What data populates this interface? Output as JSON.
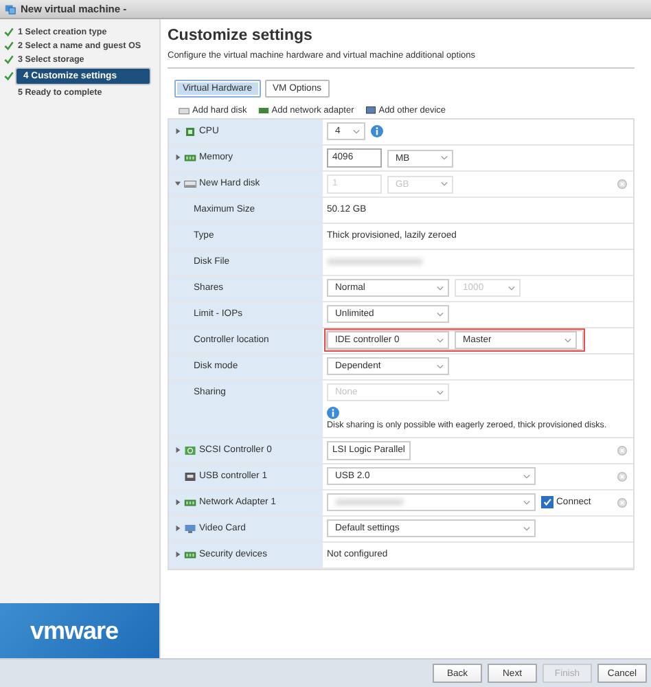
{
  "window": {
    "title": "New virtual machine -"
  },
  "steps": [
    {
      "label": "1 Select creation type",
      "done": true,
      "selected": false
    },
    {
      "label": "2 Select a name and guest OS",
      "done": true,
      "selected": false
    },
    {
      "label": "3 Select storage",
      "done": true,
      "selected": false
    },
    {
      "label": "4 Customize settings",
      "done": true,
      "selected": true
    },
    {
      "label": "5 Ready to complete",
      "done": false,
      "selected": false
    }
  ],
  "logo": "vmware",
  "heading": "Customize settings",
  "subtitle": "Configure the virtual machine hardware and virtual machine additional options",
  "tabs": [
    {
      "label": "Virtual Hardware",
      "selected": true
    },
    {
      "label": "VM Options",
      "selected": false
    }
  ],
  "toolbar": [
    "Add hard disk",
    "Add network adapter",
    "Add other device"
  ],
  "rows": [
    {
      "kind": "device",
      "label": "CPU",
      "expanded": false,
      "controls": [
        {
          "kind": "select",
          "value": "4"
        },
        {
          "kind": "info"
        }
      ]
    },
    {
      "kind": "device",
      "label": "Memory",
      "expanded": false,
      "controls": [
        {
          "kind": "input",
          "value": "4096"
        },
        {
          "kind": "select",
          "value": "MB"
        }
      ]
    },
    {
      "kind": "device",
      "label": "New Hard disk",
      "expanded": true,
      "removable": true,
      "controls": [
        {
          "kind": "input",
          "value": "1",
          "disabled": true
        },
        {
          "kind": "select",
          "value": "GB",
          "disabled": true
        }
      ]
    },
    {
      "kind": "property",
      "label": "Maximum Size",
      "controls": [
        {
          "kind": "text",
          "value": "50.12 GB"
        }
      ]
    },
    {
      "kind": "property",
      "label": "Type",
      "controls": [
        {
          "kind": "text",
          "value": "Thick provisioned, lazily zeroed"
        }
      ]
    },
    {
      "kind": "property",
      "label": "Disk File",
      "controls": [
        {
          "kind": "blurred"
        }
      ]
    },
    {
      "kind": "property",
      "label": "Shares",
      "controls": [
        {
          "kind": "select",
          "value": "Normal"
        },
        {
          "kind": "select",
          "value": "1000",
          "disabled": true
        }
      ]
    },
    {
      "kind": "property",
      "label": "Limit - IOPs",
      "controls": [
        {
          "kind": "select",
          "value": "Unlimited"
        }
      ]
    },
    {
      "kind": "property",
      "label": "Controller location",
      "highlighted": true,
      "controls": [
        {
          "kind": "select",
          "value": "IDE controller 0"
        },
        {
          "kind": "select",
          "value": "Master"
        }
      ]
    },
    {
      "kind": "property",
      "label": "Disk mode",
      "controls": [
        {
          "kind": "select",
          "value": "Dependent"
        }
      ]
    },
    {
      "kind": "property",
      "label": "Sharing",
      "controls": [
        {
          "kind": "select",
          "value": "None",
          "disabled": true
        },
        {
          "kind": "note",
          "value": "Disk sharing is only possible with eagerly zeroed, thick provisioned disks."
        }
      ]
    },
    {
      "kind": "device",
      "label": "SCSI Controller 0",
      "expanded": false,
      "removable": true,
      "controls": [
        {
          "kind": "input",
          "value": "LSI Logic Parallel"
        }
      ]
    },
    {
      "kind": "device",
      "label": "USB controller 1",
      "removable": true,
      "controls": [
        {
          "kind": "select",
          "value": "USB 2.0"
        }
      ]
    },
    {
      "kind": "device",
      "label": "Network Adapter 1",
      "expanded": false,
      "removable": true,
      "controls": [
        {
          "kind": "select",
          "blurred": true
        },
        {
          "kind": "checkbox",
          "value": "Connect",
          "checked": true
        }
      ]
    },
    {
      "kind": "device",
      "label": "Video Card",
      "expanded": false,
      "controls": [
        {
          "kind": "select",
          "value": "Default settings"
        }
      ]
    },
    {
      "kind": "device",
      "label": "Security devices",
      "expanded": false,
      "controls": [
        {
          "kind": "text",
          "value": "Not configured"
        }
      ]
    }
  ],
  "buttons": [
    {
      "label": "Back",
      "disabled": false
    },
    {
      "label": "Next",
      "disabled": false
    },
    {
      "label": "Finish",
      "disabled": true
    },
    {
      "label": "Cancel",
      "disabled": false
    }
  ]
}
